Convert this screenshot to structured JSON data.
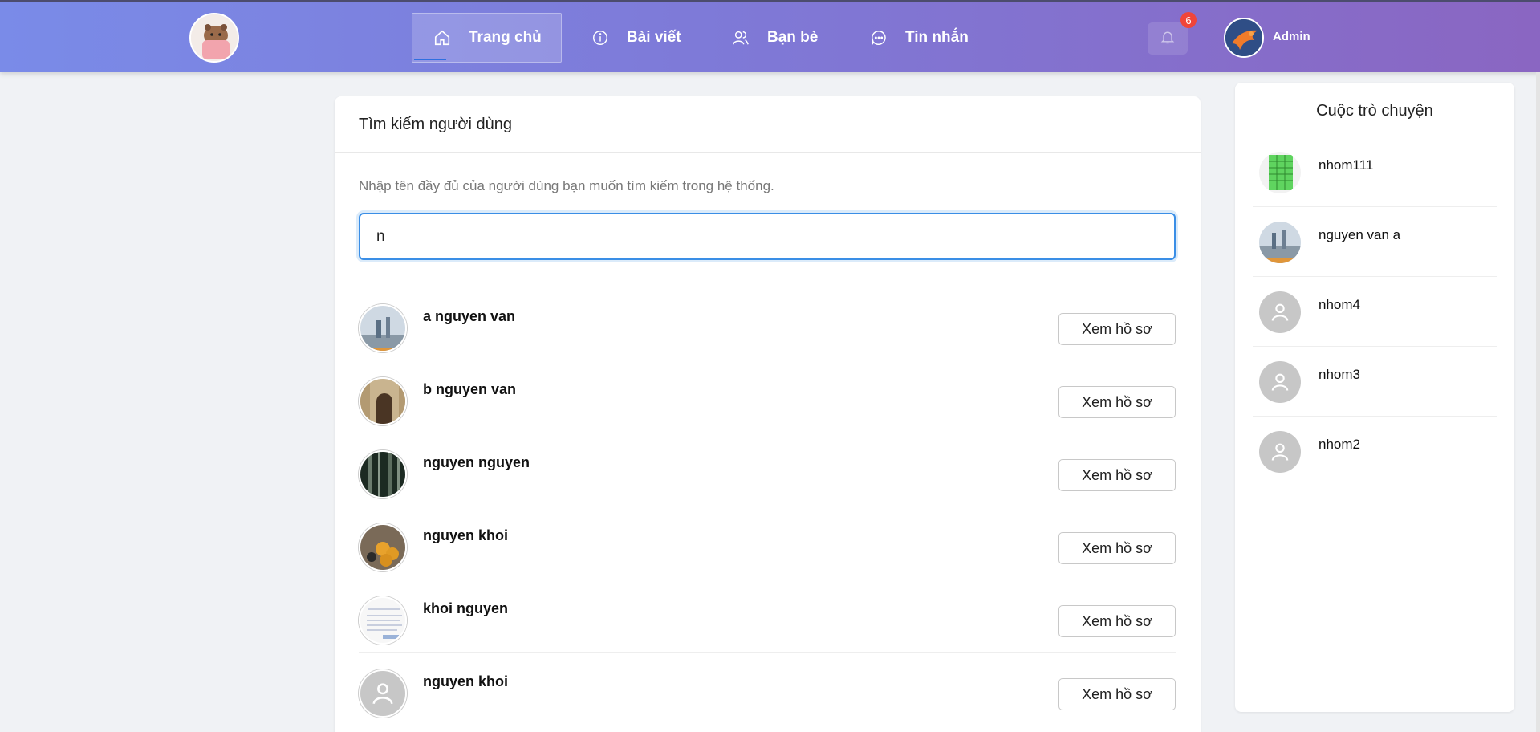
{
  "nav": {
    "items": [
      {
        "label": "Trang chủ",
        "icon": "home-icon"
      },
      {
        "label": "Bài viết",
        "icon": "info-icon"
      },
      {
        "label": "Bạn bè",
        "icon": "friends-icon"
      },
      {
        "label": "Tin nhắn",
        "icon": "chat-icon"
      }
    ],
    "notification_count": "6",
    "user_name": "Admin"
  },
  "search": {
    "title": "Tìm kiếm người dùng",
    "hint": "Nhập tên đầy đủ của người dùng bạn muốn tìm kiếm trong hệ thống.",
    "value": "n",
    "results": [
      {
        "name": "a nguyen van",
        "button": "Xem hồ sơ"
      },
      {
        "name": "b nguyen van",
        "button": "Xem hồ sơ"
      },
      {
        "name": "nguyen nguyen",
        "button": "Xem hồ sơ"
      },
      {
        "name": "nguyen khoi",
        "button": "Xem hồ sơ"
      },
      {
        "name": "khoi nguyen",
        "button": "Xem hồ sơ"
      },
      {
        "name": "nguyen khoi",
        "button": "Xem hồ sơ"
      }
    ]
  },
  "sidebar": {
    "title": "Cuộc trò chuyện",
    "conversations": [
      {
        "name": "nhom111"
      },
      {
        "name": "nguyen van a"
      },
      {
        "name": "nhom4"
      },
      {
        "name": "nhom3"
      },
      {
        "name": "nhom2"
      }
    ]
  },
  "colors": {
    "accent": "#3a8ee6",
    "badge": "#f0453a"
  }
}
